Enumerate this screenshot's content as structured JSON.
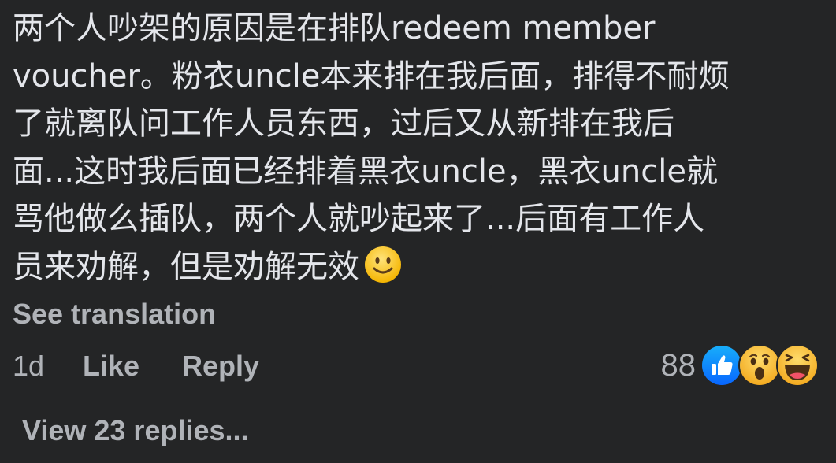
{
  "comment": {
    "lines": [
      "两个人吵架的原因是在排队redeem member",
      "voucher。粉衣uncle本来排在我后面，排得不耐烦",
      "了就离队问工作人员东西，过后又从新排在我后",
      "面...这时我后面已经排着黑衣uncle，黑衣uncle就",
      "骂他做么插队，两个人就吵起来了...后面有工作人",
      "员来劝解，但是劝解无效"
    ],
    "inline_emoji": "slightly-smiling-face-emoji",
    "see_translation": "See translation"
  },
  "actions": {
    "time": "1d",
    "like": "Like",
    "reply": "Reply"
  },
  "reactions": {
    "count": "88",
    "icons": [
      "like-reaction-icon",
      "wow-reaction-icon",
      "haha-reaction-icon"
    ],
    "colors": {
      "like": "#1877f2",
      "emoji_yellow": "#f7c23b"
    }
  },
  "replies": {
    "label": "View 23 replies..."
  }
}
